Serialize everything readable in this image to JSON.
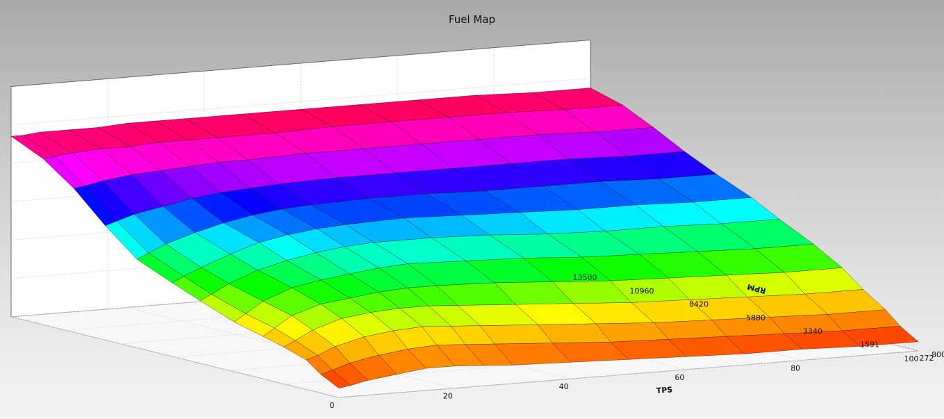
{
  "chart_data": {
    "type": "surface3d",
    "title": "Fuel Map",
    "x_axis": {
      "label": "TPS",
      "ticks": [
        "0",
        "20",
        "40",
        "60",
        "80",
        "100"
      ],
      "range": [
        0,
        100
      ]
    },
    "y_axis": {
      "label": "RPM",
      "ticks": [
        "272",
        "1591",
        "3340",
        "5880",
        "8420",
        "10960",
        "13500"
      ],
      "range": [
        272,
        13500
      ]
    },
    "z_axis_partial_label": "800",
    "grid": true,
    "colormap": [
      "#ff0000",
      "#ff8000",
      "#ffff00",
      "#00ff00",
      "#00ffff",
      "#0000ff",
      "#ff00ff",
      "#ff0040"
    ],
    "surface_note_values_relative": true,
    "z_relative": {
      "tps_points": [
        0,
        2,
        5,
        10,
        15,
        20,
        25,
        30,
        40,
        50,
        60,
        70,
        80,
        90,
        100
      ],
      "rpm_points": [
        272,
        1000,
        1591,
        2500,
        3340,
        4500,
        5880,
        7000,
        8420,
        9700,
        10960,
        12200,
        13500
      ],
      "rows": [
        [
          0.05,
          0.1,
          0.16,
          0.2,
          0.23,
          0.27,
          0.34,
          0.4,
          0.48,
          0.62,
          0.78,
          0.9,
          0.98
        ],
        [
          0.06,
          0.12,
          0.18,
          0.23,
          0.27,
          0.31,
          0.37,
          0.43,
          0.51,
          0.64,
          0.79,
          0.91,
          0.98
        ],
        [
          0.08,
          0.15,
          0.22,
          0.28,
          0.33,
          0.37,
          0.42,
          0.47,
          0.55,
          0.67,
          0.81,
          0.92,
          0.99
        ],
        [
          0.1,
          0.18,
          0.26,
          0.33,
          0.38,
          0.43,
          0.48,
          0.53,
          0.6,
          0.7,
          0.83,
          0.93,
          0.99
        ],
        [
          0.12,
          0.2,
          0.28,
          0.35,
          0.4,
          0.46,
          0.52,
          0.58,
          0.64,
          0.73,
          0.84,
          0.93,
          0.99
        ],
        [
          0.12,
          0.21,
          0.29,
          0.36,
          0.42,
          0.48,
          0.55,
          0.61,
          0.67,
          0.75,
          0.85,
          0.94,
          1.0
        ],
        [
          0.11,
          0.2,
          0.28,
          0.36,
          0.43,
          0.5,
          0.57,
          0.63,
          0.69,
          0.76,
          0.86,
          0.94,
          1.0
        ],
        [
          0.1,
          0.19,
          0.27,
          0.35,
          0.43,
          0.51,
          0.58,
          0.64,
          0.7,
          0.77,
          0.86,
          0.94,
          1.0
        ],
        [
          0.09,
          0.17,
          0.25,
          0.33,
          0.42,
          0.5,
          0.58,
          0.65,
          0.71,
          0.78,
          0.87,
          0.94,
          1.0
        ],
        [
          0.08,
          0.15,
          0.23,
          0.31,
          0.4,
          0.49,
          0.57,
          0.64,
          0.71,
          0.78,
          0.87,
          0.95,
          1.0
        ],
        [
          0.07,
          0.14,
          0.21,
          0.29,
          0.38,
          0.47,
          0.55,
          0.63,
          0.7,
          0.78,
          0.87,
          0.95,
          1.0
        ],
        [
          0.06,
          0.13,
          0.2,
          0.28,
          0.37,
          0.46,
          0.54,
          0.62,
          0.7,
          0.78,
          0.87,
          0.95,
          1.0
        ],
        [
          0.06,
          0.12,
          0.19,
          0.27,
          0.36,
          0.45,
          0.54,
          0.62,
          0.7,
          0.78,
          0.87,
          0.95,
          1.0
        ],
        [
          0.05,
          0.11,
          0.18,
          0.26,
          0.35,
          0.44,
          0.53,
          0.61,
          0.69,
          0.77,
          0.86,
          0.94,
          0.99
        ],
        [
          0.05,
          0.11,
          0.18,
          0.26,
          0.35,
          0.44,
          0.53,
          0.61,
          0.69,
          0.77,
          0.86,
          0.94,
          0.99
        ]
      ]
    }
  }
}
